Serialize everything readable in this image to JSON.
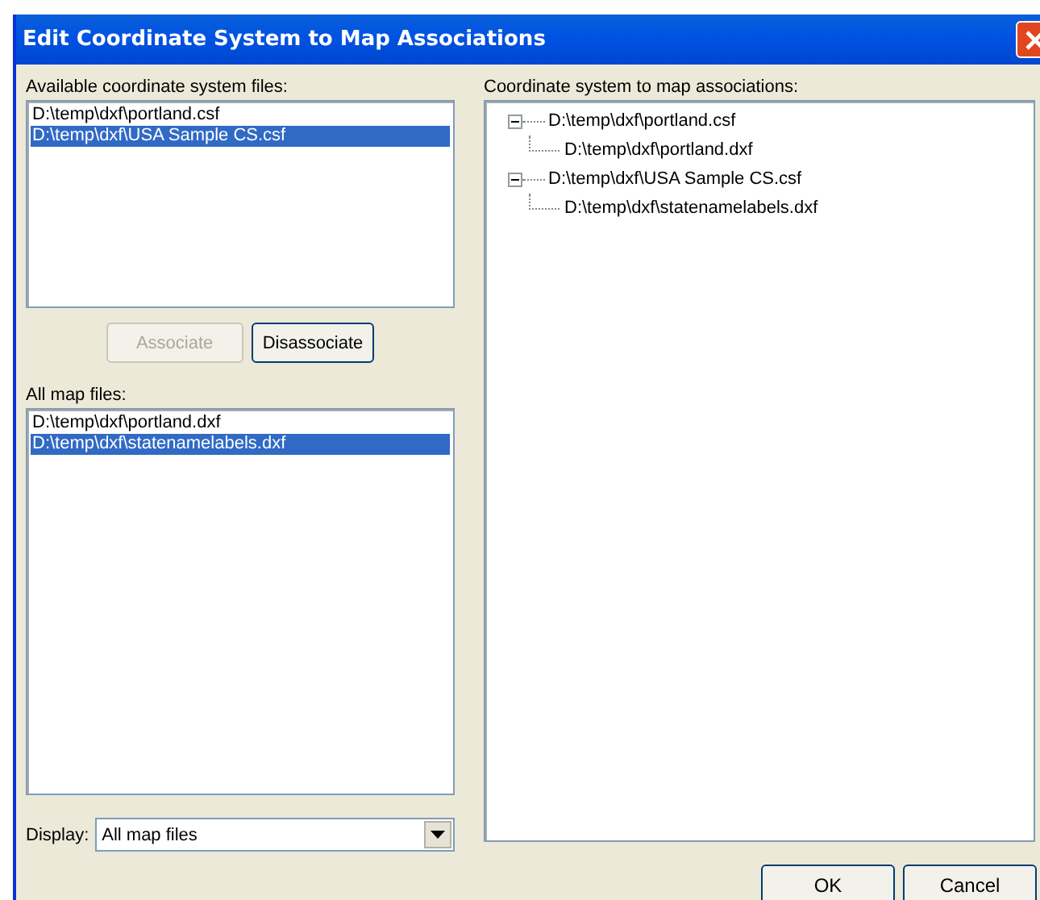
{
  "window": {
    "title": "Edit Coordinate System to Map Associations"
  },
  "coordinate_files": {
    "label": "Available coordinate system files:",
    "items": [
      {
        "text": "D:\\temp\\dxf\\portland.csf",
        "selected": false
      },
      {
        "text": "D:\\temp\\dxf\\USA Sample CS.csf",
        "selected": true
      }
    ]
  },
  "buttons": [
    {
      "label": "Associate",
      "disabled": true
    },
    {
      "label": "Disassociate",
      "disabled": false
    }
  ],
  "map_files": {
    "label": "All map files:",
    "items": [
      {
        "text": "D:\\temp\\dxf\\portland.dxf",
        "selected": false
      },
      {
        "text": "D:\\temp\\dxf\\statenamelabels.dxf",
        "selected": true
      }
    ]
  },
  "display": {
    "label": "Display:",
    "value": "All map files"
  },
  "associations": {
    "label": "Coordinate system to map associations:",
    "tree": [
      {
        "text": "D:\\temp\\dxf\\portland.csf",
        "expanded": true,
        "children": [
          {
            "text": "D:\\temp\\dxf\\portland.dxf"
          }
        ]
      },
      {
        "text": "D:\\temp\\dxf\\USA Sample CS.csf",
        "expanded": true,
        "children": [
          {
            "text": "D:\\temp\\dxf\\statenamelabels.dxf"
          }
        ]
      }
    ]
  },
  "footer_buttons": [
    "OK",
    "Cancel"
  ]
}
